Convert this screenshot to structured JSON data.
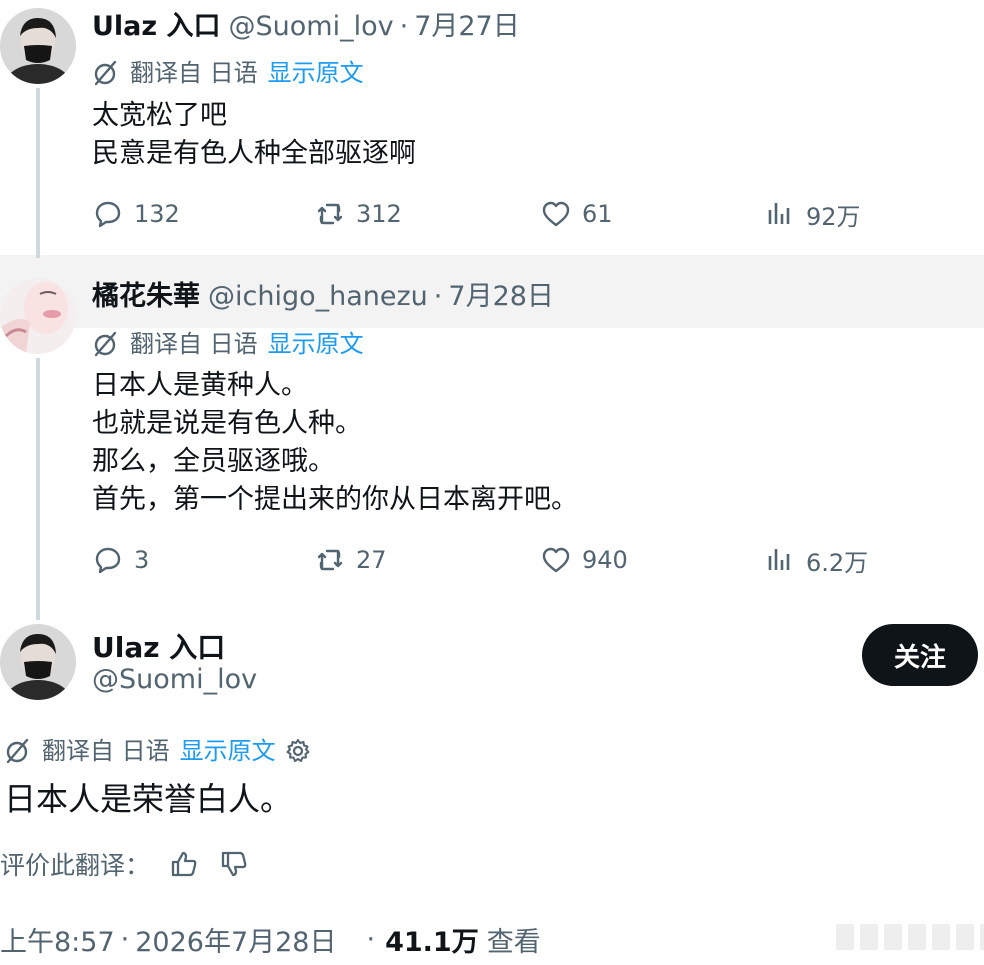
{
  "colors": {
    "link": "#1d9bf0",
    "muted": "#536471",
    "text": "#0f1419",
    "thread_line": "#cfd9de",
    "follow_bg": "#0f1419"
  },
  "tweet1": {
    "name": "Ulaz 入口",
    "handle": "@Suomi_lov",
    "sep": "·",
    "date": "7月27日",
    "translate": {
      "label": "翻译自 日语",
      "link": "显示原文",
      "icon": "translate-icon"
    },
    "lines": [
      "太宽松了吧",
      "民意是有色人种全部驱逐啊"
    ],
    "actions": {
      "replies": "132",
      "retweets": "312",
      "likes": "61",
      "views": "92万"
    }
  },
  "tweet2": {
    "name": "橘花朱華",
    "handle": "@ichigo_hanezu",
    "sep": "·",
    "date": "7月28日",
    "translate": {
      "label": "翻译自 日语",
      "link": "显示原文",
      "icon": "translate-icon"
    },
    "lines": [
      "日本人是黄种人。",
      "也就是说是有色人种。",
      "那么，全员驱逐哦。",
      "首先，第一个提出来的你从日本离开吧。"
    ],
    "actions": {
      "replies": "3",
      "retweets": "27",
      "likes": "940",
      "views": "6.2万"
    }
  },
  "main": {
    "name": "Ulaz 入口",
    "handle": "@Suomi_lov",
    "follow_label": "关注",
    "translate": {
      "label": "翻译自 日语",
      "link": "显示原文",
      "icon": "translate-icon"
    },
    "text": "日本人是荣誉白人。",
    "rate_label": "评价此翻译：",
    "meta": {
      "time": "上午8:57",
      "sep": "·",
      "date": "2026年7月28日",
      "sep2": "·",
      "views": "41.1万",
      "views_label": "查看"
    }
  }
}
